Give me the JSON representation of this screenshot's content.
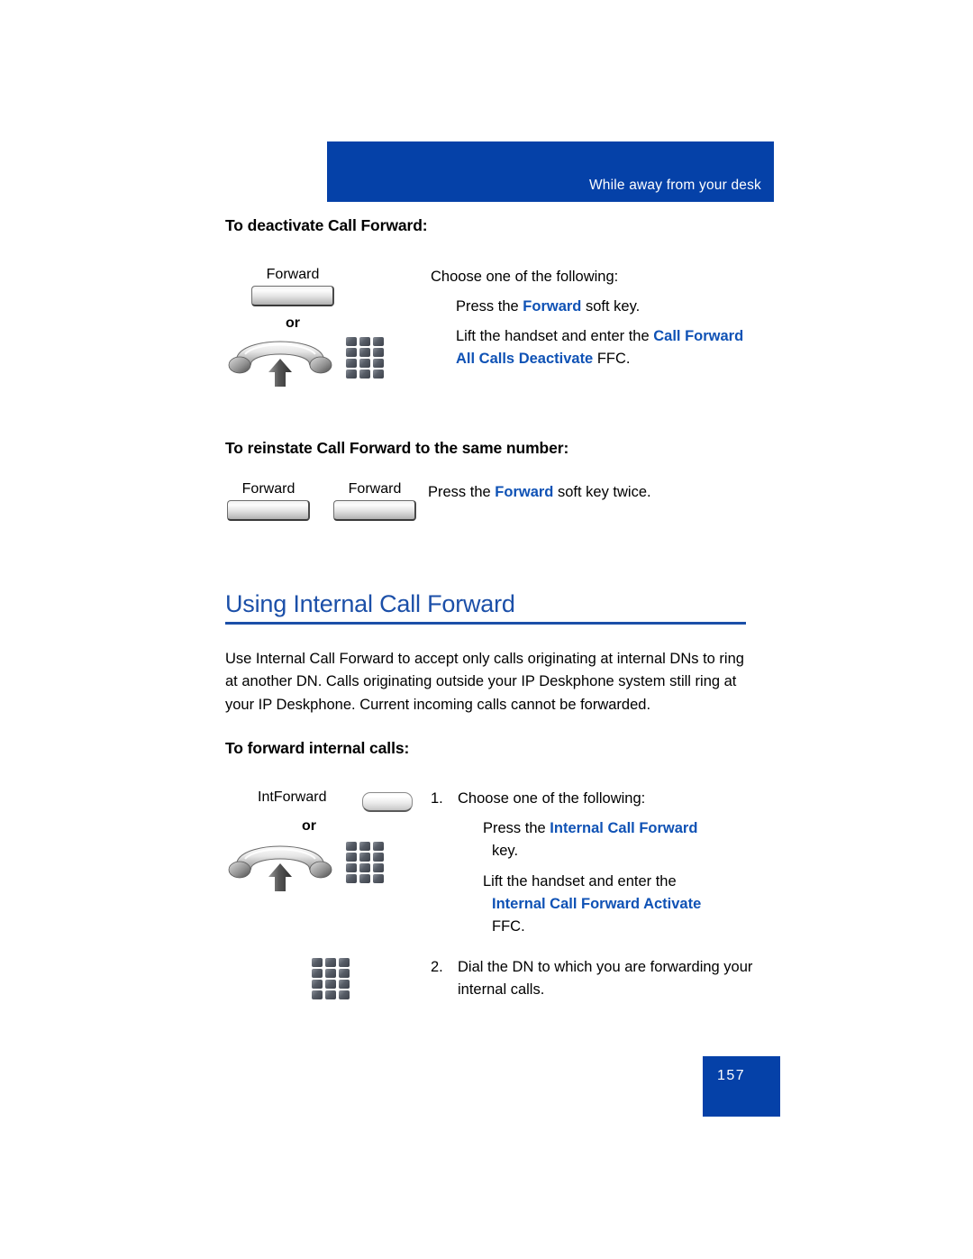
{
  "header": {
    "title": "While away from your desk"
  },
  "sections": {
    "deactivate": {
      "title": "To deactivate Call Forward:",
      "softkey_label": "Forward",
      "or_label": "or",
      "line_choose": "Choose one of the following:",
      "line_press_pre": "Press the ",
      "line_press_key": "Forward",
      "line_press_post": " soft key.",
      "line_lift_pre": "Lift the handset and enter the ",
      "line_lift_ffc": "Call Forward All Calls Deactivate",
      "line_lift_post": " FFC."
    },
    "reinstate": {
      "title": "To reinstate Call Forward to the same number:",
      "softkey_label_1": "Forward",
      "softkey_label_2": "Forward",
      "line_pre": "Press the ",
      "line_key": "Forward",
      "line_post": " soft key twice."
    },
    "internal": {
      "heading": "Using Internal Call Forward",
      "paragraph": "Use Internal Call Forward to accept only calls originating at internal DNs to ring at another DN. Calls originating outside your IP Deskphone system still ring at your IP Deskphone. Current incoming calls cannot be forwarded.",
      "title": "To forward internal calls:",
      "softkey_label": "IntForward",
      "or_label": "or",
      "step1_num": "1.",
      "step1_text": "Choose one of the following:",
      "step1a_pre": "Press the  ",
      "step1a_key": "Internal Call Forward",
      "step1a_post": "key.",
      "step1b_pre": "Lift the handset and enter the ",
      "step1b_key": "Internal Call Forward Activate",
      "step1b_post": "FFC.",
      "step2_num": "2.",
      "step2_text": "Dial the DN to which you are forwarding your internal calls."
    }
  },
  "footer": {
    "page_number": "157"
  },
  "colors": {
    "brand_blue": "#0541a8",
    "link_blue": "#0f52b5",
    "heading_blue": "#1b4fa8"
  }
}
